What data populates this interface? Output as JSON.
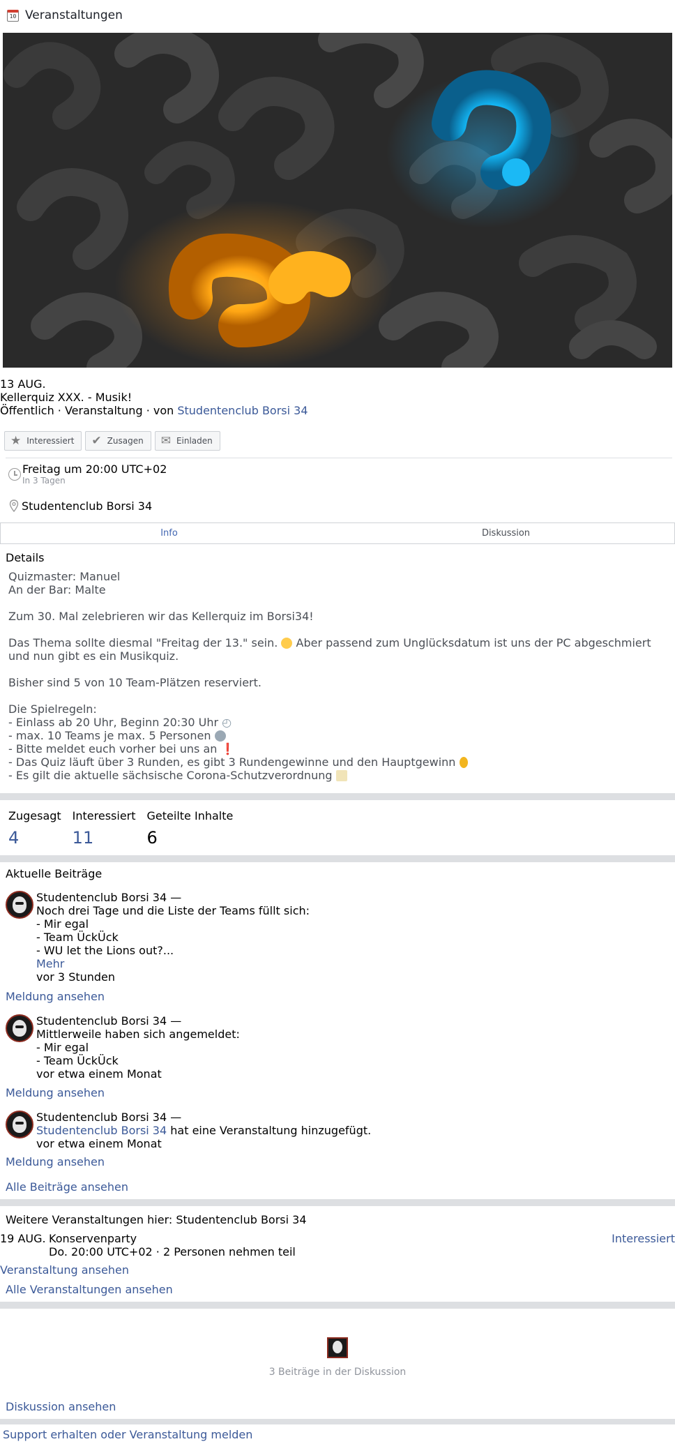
{
  "topbar": {
    "icon": "calendar-icon",
    "calendar_day": "10",
    "title": "Veranstaltungen"
  },
  "event": {
    "date": "13 AUG.",
    "title": "Kellerquiz XXX. - Musik!",
    "meta_prefix": "Öffentlich · Veranstaltung · von ",
    "host": "Studentenclub Borsi 34"
  },
  "actions": {
    "interested": "Interessiert",
    "accept": "Zusagen",
    "invite": "Einladen"
  },
  "time": {
    "main": "Freitag um 20:00 UTC+02",
    "sub": "In 3 Tagen"
  },
  "location": "Studentenclub Borsi 34",
  "tabs": [
    {
      "label": "Info"
    },
    {
      "label": "Diskussion"
    }
  ],
  "details": {
    "title": "Details",
    "lines": [
      "Quizmaster: Manuel",
      "An der Bar: Malte",
      "",
      "Zum 30. Mal zelebrieren wir das Kellerquiz im Borsi34!",
      "",
      "Das Thema sollte diesmal \"Freitag der 13.\" sein.",
      "Aber passend zum Unglücksdatum ist uns der PC abgeschmiert und nun gibt es ein Musikquiz.",
      "",
      "Bisher sind 5 von 10 Team-Plätzen reserviert.",
      "",
      "Die Spielregeln:",
      "- Einlass ab 20 Uhr, Beginn 20:30 Uhr",
      "- max. 10 Teams je max. 5 Personen",
      "- Bitte meldet euch vorher bei uns an",
      "- Das Quiz läuft über 3 Runden, es gibt 3 Rundengewinne und den Hauptgewinn",
      "- Es gilt die aktuelle sächsische Corona-Schutzverordnung"
    ]
  },
  "stats": [
    {
      "label": "Zugesagt",
      "value": "4"
    },
    {
      "label": "Interessiert",
      "value": "11"
    },
    {
      "label": "Geteilte Inhalte",
      "value": "6"
    }
  ],
  "posts_section": {
    "title": "Aktuelle Beiträge",
    "posts": [
      {
        "author": "Studentenclub Borsi 34 —",
        "lines": [
          "Noch drei Tage und die Liste der Teams füllt sich:",
          "- Mir egal",
          "- Team ÜckÜck",
          "- WU let the Lions out?..."
        ],
        "more": "Mehr",
        "time": "vor 3 Stunden",
        "link": "Meldung ansehen"
      },
      {
        "author": "Studentenclub Borsi 34 —",
        "lines": [
          "Mittlerweile haben sich angemeldet:",
          "- Mir egal",
          "- Team ÜckÜck"
        ],
        "time": "vor etwa einem Monat",
        "link": "Meldung ansehen"
      },
      {
        "author": "Studentenclub Borsi 34 —",
        "actor": "Studentenclub Borsi 34",
        "action": " hat eine Veranstaltung hinzugefügt.",
        "time": "vor etwa einem Monat",
        "link": "Meldung ansehen"
      }
    ],
    "all_link": "Alle Beiträge ansehen"
  },
  "more_events": {
    "title": "Weitere Veranstaltungen hier: Studentenclub Borsi 34",
    "items": [
      {
        "date": "19 AUG.",
        "name": "Konservenparty",
        "info": "Do. 20:00 UTC+02 · 2 Personen nehmen teil",
        "action": "Interessiert"
      }
    ],
    "view_link": "Veranstaltung ansehen",
    "all_link": "Alle Veranstaltungen ansehen"
  },
  "discussion": {
    "count": "3 Beiträge in der Diskussion",
    "link": "Diskussion ansehen"
  },
  "footer": {
    "support_link": "Support erhalten oder Veranstaltung melden"
  }
}
